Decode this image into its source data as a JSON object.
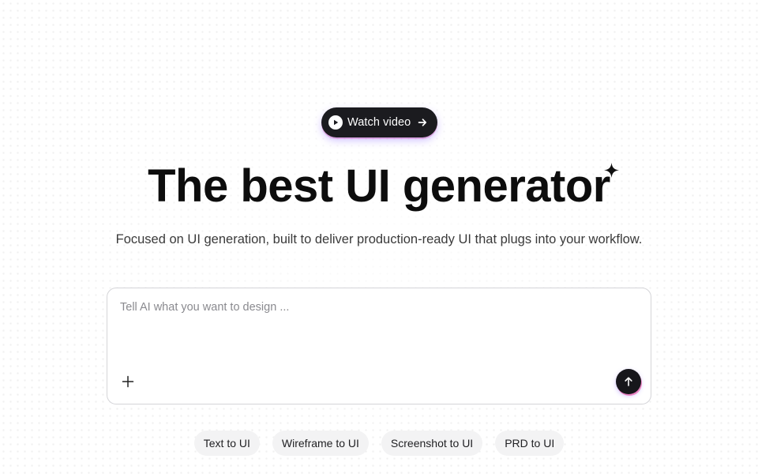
{
  "watch_button": {
    "label": "Watch video",
    "icon": "play-icon",
    "trailing_icon": "arrow-right-icon"
  },
  "hero": {
    "title": "The best UI generator",
    "title_icon": "sparkle-icon",
    "subtitle": "Focused on UI generation, built to deliver production-ready UI that plugs into your workflow."
  },
  "prompt": {
    "placeholder": "Tell AI what you want to design ...",
    "value": "",
    "add_icon": "plus-icon",
    "send_icon": "arrow-up-icon"
  },
  "modes": [
    {
      "label": "Text to UI"
    },
    {
      "label": "Wireframe to UI"
    },
    {
      "label": "Screenshot to UI"
    },
    {
      "label": "PRD to UI"
    }
  ],
  "colors": {
    "button_bg": "#1b1b1f",
    "text": "#0d0d0d",
    "subtitle": "#3a3a3a",
    "chip_bg": "#f3f3f4",
    "border": "#d4d4d8",
    "glow_purple": "#8b5cf6",
    "glow_pink": "#ec4899"
  }
}
